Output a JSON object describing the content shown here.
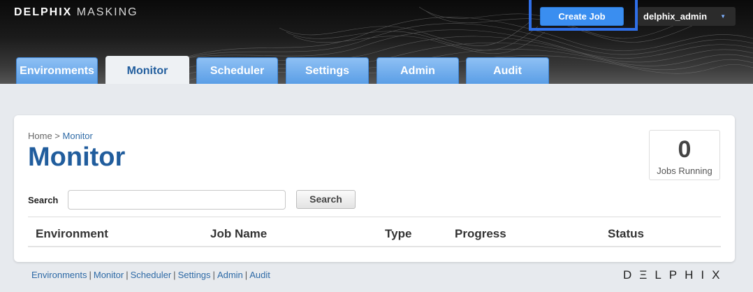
{
  "header": {
    "brand_bold": "DELPHIX",
    "brand_light": "MASKING",
    "create_job_label": "Create Job",
    "user_name": "delphix_admin",
    "user_caret": "▼"
  },
  "tabs": [
    {
      "label": "Environments"
    },
    {
      "label": "Monitor",
      "active": true
    },
    {
      "label": "Scheduler"
    },
    {
      "label": "Settings"
    },
    {
      "label": "Admin"
    },
    {
      "label": "Audit"
    }
  ],
  "breadcrumb": {
    "home": "Home",
    "separator": " > ",
    "current": "Monitor"
  },
  "page_title": "Monitor",
  "jobs_running": {
    "count": "0",
    "label": "Jobs Running"
  },
  "search": {
    "label": "Search",
    "value": "",
    "placeholder": "",
    "button_label": "Search"
  },
  "table": {
    "columns": [
      "Environment",
      "Job Name",
      "Type",
      "Progress",
      "Status"
    ],
    "rows": []
  },
  "footer": {
    "links": [
      "Environments",
      "Monitor",
      "Scheduler",
      "Settings",
      "Admin",
      "Audit"
    ],
    "separator": "|",
    "logo_text": "DΞLPHIX"
  },
  "colors": {
    "accent_blue": "#3a8ef0",
    "tab_blue": "#5a9ee6",
    "title_blue": "#215d9d",
    "highlight_frame": "#2f6fe8"
  }
}
